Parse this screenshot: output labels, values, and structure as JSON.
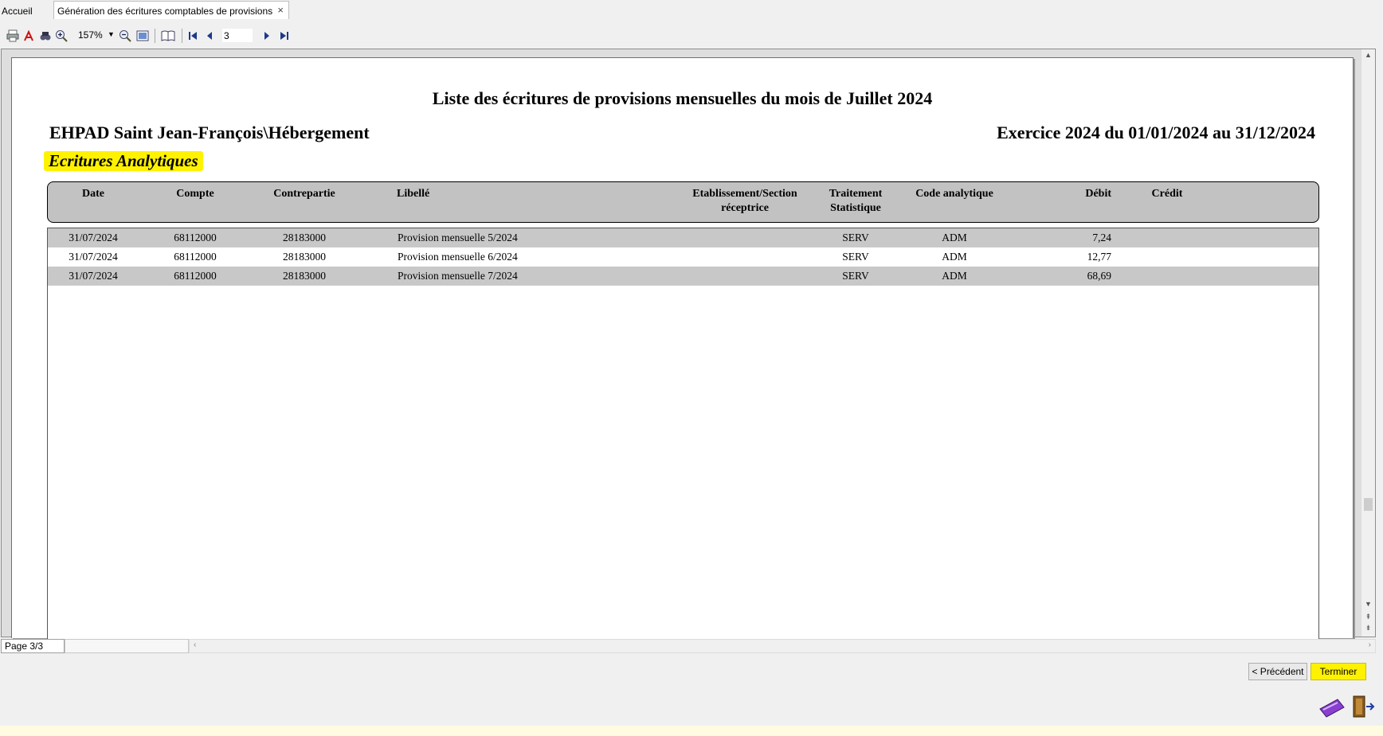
{
  "tabs": {
    "home": "Accueil",
    "active": "Génération des écritures comptables de provisions",
    "close": "×"
  },
  "toolbar": {
    "icons": [
      "print-icon",
      "pdf-icon",
      "find-icon",
      "zoom-in-icon",
      "zoom-out-icon",
      "page-view-icon",
      "book-icon",
      "first-page-icon",
      "prev-page-icon",
      "next-page-icon",
      "last-page-icon"
    ],
    "zoom": "157%",
    "page_input": "3"
  },
  "report": {
    "title": "Liste des écritures de provisions mensuelles du mois de Juillet 2024",
    "organization": "EHPAD Saint Jean-François\\Hébergement",
    "exercise": "Exercice 2024 du 01/01/2024 au 31/12/2024",
    "section": "Ecritures Analytiques",
    "columns": {
      "date": "Date",
      "compte": "Compte",
      "contrepartie": "Contrepartie",
      "libelle": "Libellé",
      "etablissement_1": "Etablissement/Section",
      "etablissement_2": "réceptrice",
      "traitement_1": "Traitement",
      "traitement_2": "Statistique",
      "code": "Code analytique",
      "debit": "Débit",
      "credit": "Crédit"
    },
    "rows": [
      {
        "date": "31/07/2024",
        "compte": "68112000",
        "contrepartie": "28183000",
        "libelle": "Provision mensuelle 5/2024",
        "etablissement": "",
        "traitement": "SERV",
        "code": "ADM",
        "debit": "7,24",
        "credit": ""
      },
      {
        "date": "31/07/2024",
        "compte": "68112000",
        "contrepartie": "28183000",
        "libelle": "Provision mensuelle 6/2024",
        "etablissement": "",
        "traitement": "SERV",
        "code": "ADM",
        "debit": "12,77",
        "credit": ""
      },
      {
        "date": "31/07/2024",
        "compte": "68112000",
        "contrepartie": "28183000",
        "libelle": "Provision mensuelle 7/2024",
        "etablissement": "",
        "traitement": "SERV",
        "code": "ADM",
        "debit": "68,69",
        "credit": ""
      }
    ]
  },
  "status": {
    "page": "Page 3/3"
  },
  "buttons": {
    "previous": "< Précédent",
    "finish": "Terminer"
  },
  "colors": {
    "highlight": "#fff200",
    "header_bg": "#c2c2c2",
    "row_shade": "#c8c8c8"
  }
}
